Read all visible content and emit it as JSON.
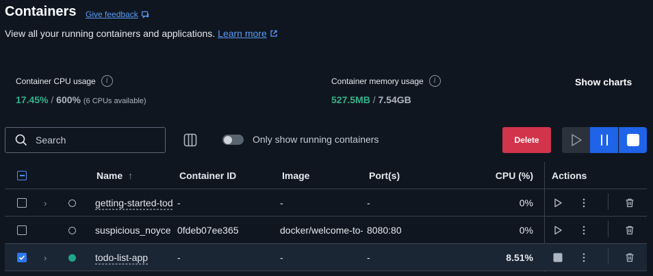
{
  "header": {
    "title": "Containers",
    "feedback_label": "Give feedback",
    "subtitle": "View all your running containers and applications.",
    "learn_more_label": "Learn more"
  },
  "stats": {
    "cpu_label": "Container CPU usage",
    "cpu_used": "17.45%",
    "cpu_separator": "/",
    "cpu_total": "600%",
    "cpu_note": "(6 CPUs available)",
    "mem_label": "Container memory usage",
    "mem_used": "527.5MB",
    "mem_separator": "/",
    "mem_total": "7.54GB",
    "show_charts_label": "Show charts"
  },
  "toolbar": {
    "search_placeholder": "Search",
    "toggle_label": "Only show running containers",
    "toggle_on": false,
    "delete_label": "Delete"
  },
  "table": {
    "headers": {
      "name": "Name",
      "container_id": "Container ID",
      "image": "Image",
      "ports": "Port(s)",
      "cpu": "CPU (%)",
      "actions": "Actions"
    },
    "rows": [
      {
        "name": "getting-started-todo-list",
        "container_id": "-",
        "image": "-",
        "ports": "-",
        "cpu": "0%",
        "status": "stopped",
        "checked": false,
        "expandable": true
      },
      {
        "name": "suspicious_noyce",
        "container_id": "0fdeb07ee365",
        "image": "docker/welcome-to-docker",
        "ports": "8080:80",
        "cpu": "0%",
        "status": "stopped",
        "checked": false,
        "expandable": false
      },
      {
        "name": "todo-list-app",
        "container_id": "-",
        "image": "-",
        "ports": "-",
        "cpu": "8.51%",
        "status": "running",
        "checked": true,
        "expandable": true
      }
    ]
  },
  "colors": {
    "background": "#0f1620",
    "accent_blue": "#1f63e8",
    "delete_red": "#d1344b",
    "green": "#35b38b"
  },
  "icons": [
    "feedback-icon",
    "external-link-icon",
    "info-icon",
    "search-icon",
    "columns-icon",
    "play-icon",
    "pause-icon",
    "stop-icon",
    "chevron-right-icon",
    "kebab-menu-icon",
    "trash-icon",
    "sort-arrow-up-icon"
  ]
}
